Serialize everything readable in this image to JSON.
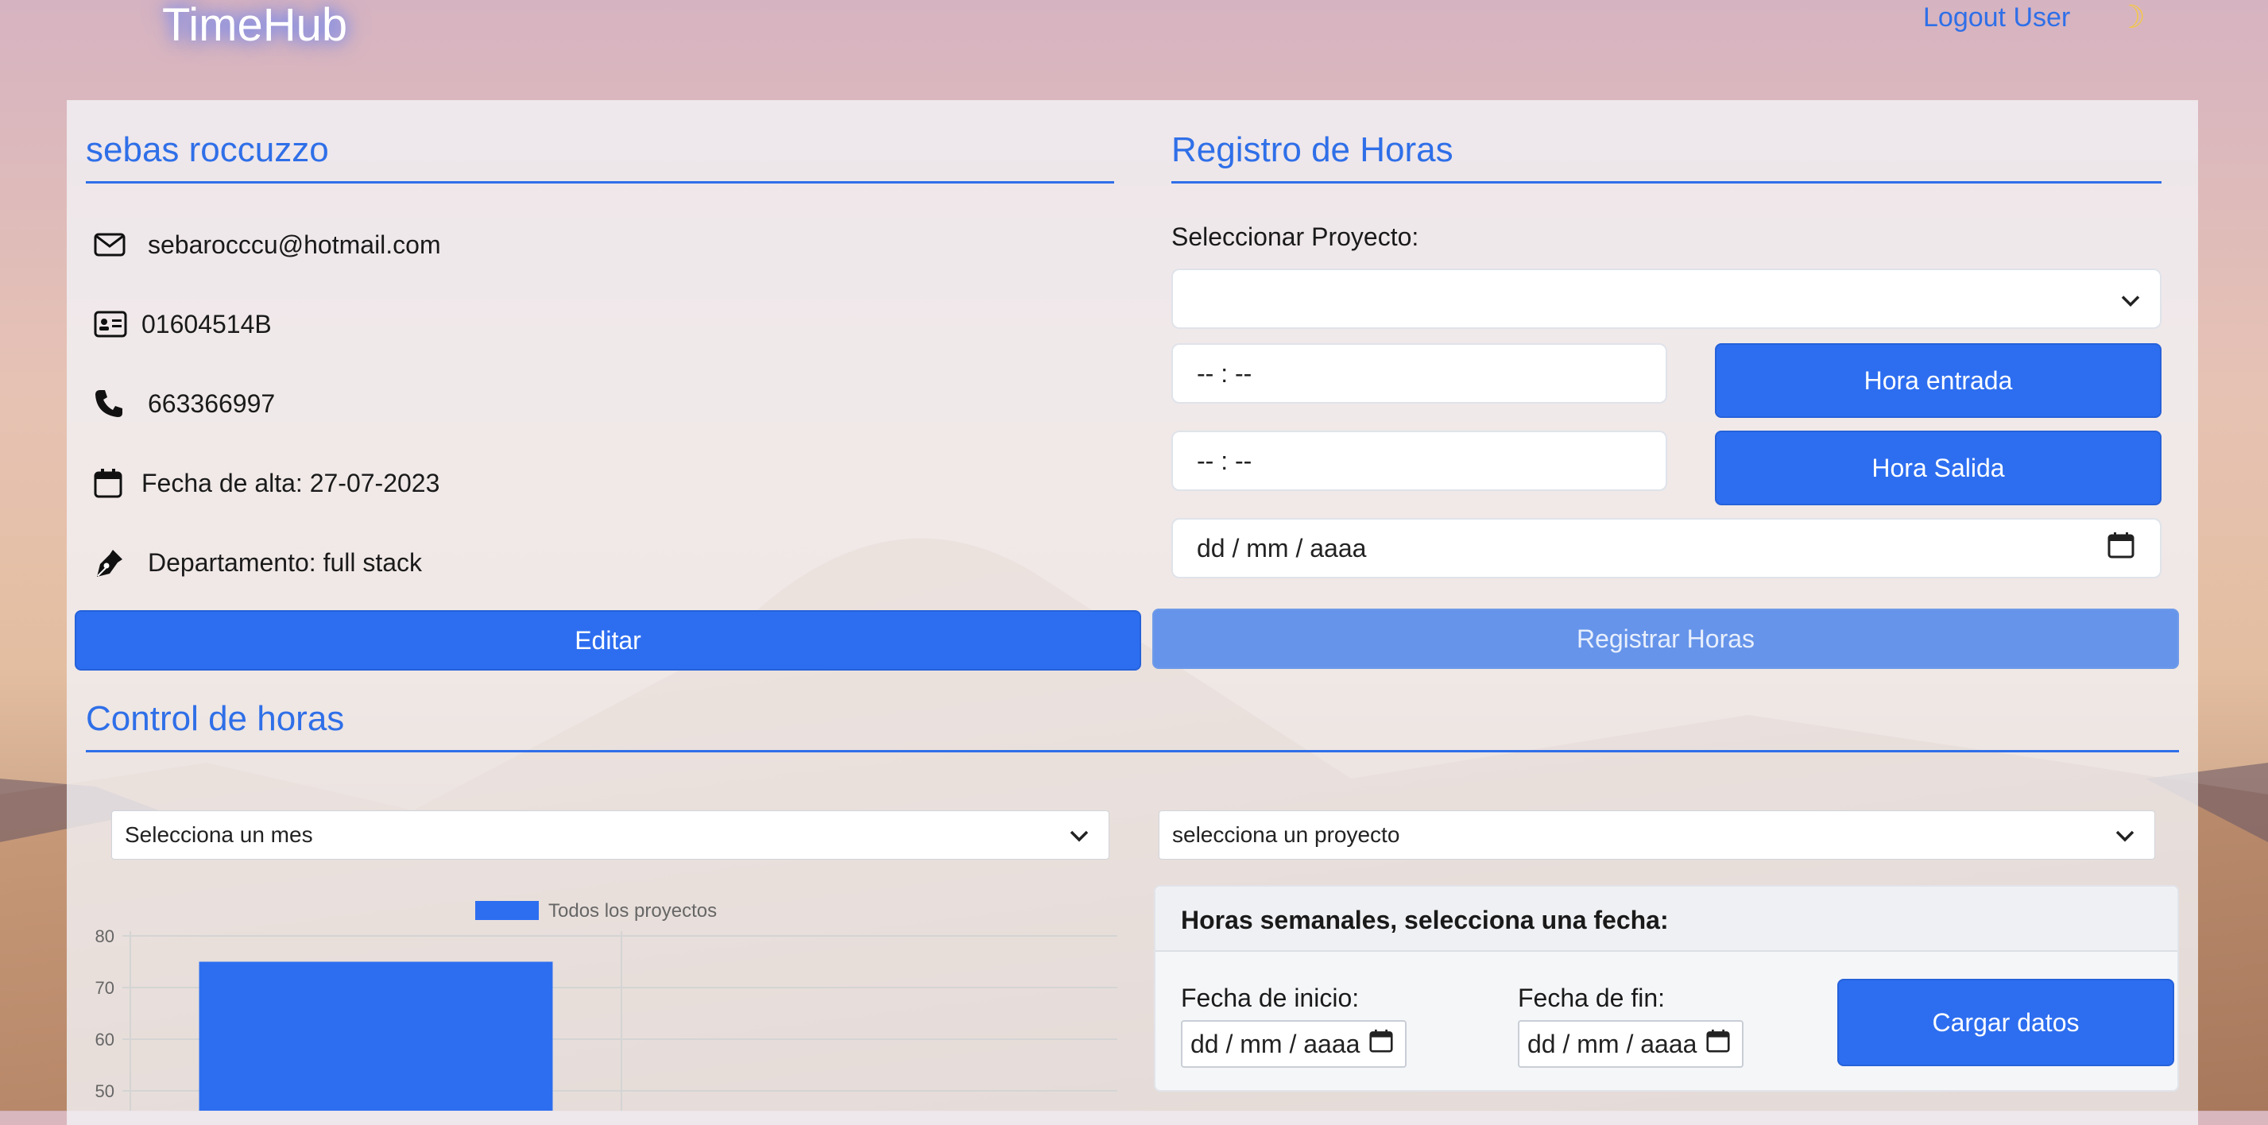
{
  "header": {
    "brand": "TimeHub",
    "logout_label": "Logout User",
    "theme_icon": "moon-icon"
  },
  "profile": {
    "name": "sebas roccuzzo",
    "email": "sebarocccu@hotmail.com",
    "id_number": "01604514B",
    "phone": "663366997",
    "join_date": "Fecha de alta: 27-07-2023",
    "department": "Departamento: full stack",
    "edit_label": "Editar"
  },
  "registro": {
    "title": "Registro de Horas",
    "project_label": "Seleccionar Proyecto:",
    "project_value": "",
    "time_in_value": "-- : --",
    "time_out_value": "-- : --",
    "hora_entrada_label": "Hora entrada",
    "hora_salida_label": "Hora Salida",
    "date_placeholder": "dd / mm / aaaa",
    "registrar_label": "Registrar Horas"
  },
  "control": {
    "title": "Control de horas",
    "month_select": "Selecciona un mes",
    "project_select": "selecciona un proyecto"
  },
  "weekly": {
    "title": "Horas semanales, selecciona una fecha:",
    "start_label": "Fecha de inicio:",
    "end_label": "Fecha de fin:",
    "start_placeholder": "dd / mm / aaaa",
    "end_placeholder": "dd / mm / aaaa",
    "load_label": "Cargar datos"
  },
  "colors": {
    "accent": "#2d6ef0",
    "title_blue": "#2f6fe8"
  },
  "chart_data": {
    "type": "bar",
    "categories": [
      ""
    ],
    "series": [
      {
        "name": "Todos los proyectos",
        "values": [
          75
        ]
      }
    ],
    "y_ticks": [
      50,
      60,
      70,
      80
    ],
    "ylim": [
      40,
      80
    ],
    "legend": "top",
    "grid": true
  }
}
